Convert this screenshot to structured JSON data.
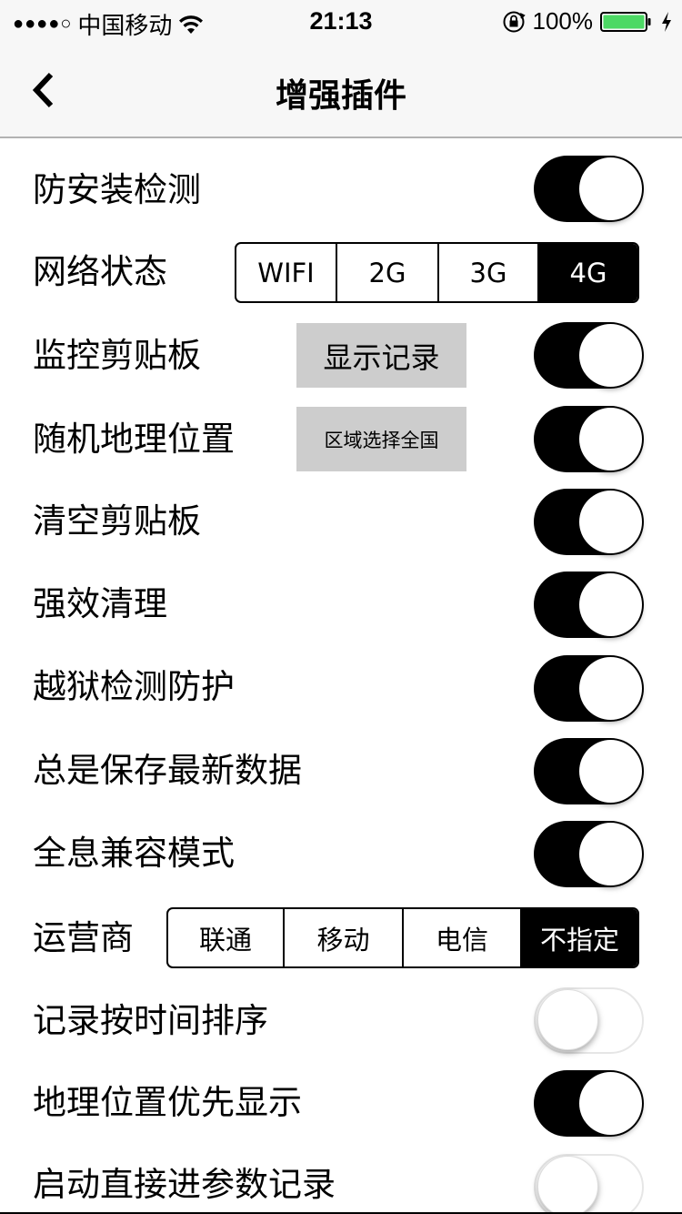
{
  "status_bar": {
    "signal": "●●●●○",
    "carrier": "中国移动",
    "time": "21:13",
    "battery_percent": "100%"
  },
  "nav": {
    "title": "增强插件"
  },
  "rows": {
    "anti_install_detect": {
      "label": "防安装检测",
      "toggle_on": true
    },
    "network_status": {
      "label": "网络状态",
      "options": [
        "WIFI",
        "2G",
        "3G",
        "4G"
      ],
      "selected": "4G"
    },
    "monitor_clipboard": {
      "label": "监控剪贴板",
      "button": "显示记录",
      "toggle_on": true
    },
    "random_location": {
      "label": "随机地理位置",
      "button": "区域选择全国",
      "toggle_on": true
    },
    "clear_clipboard": {
      "label": "清空剪贴板",
      "toggle_on": true
    },
    "strong_clean": {
      "label": "强效清理",
      "toggle_on": true
    },
    "jailbreak_protect": {
      "label": "越狱检测防护",
      "toggle_on": true
    },
    "always_save_latest": {
      "label": "总是保存最新数据",
      "toggle_on": true
    },
    "full_compat_mode": {
      "label": "全息兼容模式",
      "toggle_on": true
    },
    "carrier_select": {
      "label": "运营商",
      "options": [
        "联通",
        "移动",
        "电信",
        "不指定"
      ],
      "selected": "不指定"
    },
    "sort_records_by_time": {
      "label": "记录按时间排序",
      "toggle_on": false
    },
    "location_priority": {
      "label": "地理位置优先显示",
      "toggle_on": true
    },
    "launch_to_records": {
      "label": "启动直接进参数记录",
      "toggle_on": false
    }
  },
  "colors": {
    "toggle_on": "#000000",
    "toggle_off": "#ffffff",
    "bar_background": "#f7f7f7",
    "gray_button": "#cdcdcd",
    "battery_green": "#4cd964"
  }
}
